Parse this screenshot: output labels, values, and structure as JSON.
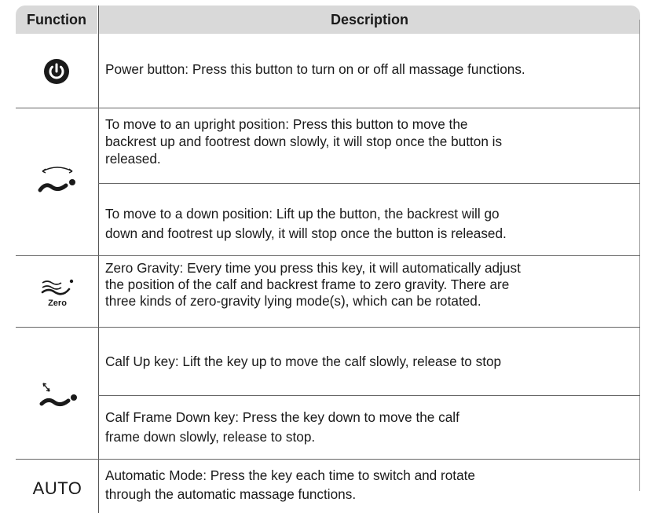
{
  "header": {
    "function": "Function",
    "description": "Description"
  },
  "rows": [
    {
      "icon": "power-icon",
      "lines": [
        "Power button: Press this button to turn on or off all massage functions."
      ]
    },
    {
      "icon": "recline-up-down-icon",
      "lines": [
        "To move to an upright position: Press this button to move the",
        "backrest up and footrest down slowly, it will stop once the button is",
        "released."
      ],
      "lines2": [
        "To move to a down position: Lift up the button, the backrest will go",
        "down and footrest up slowly, it will stop once the button is released."
      ]
    },
    {
      "icon": "zero-gravity-icon",
      "icon_label": "Zero",
      "lines": [
        "Zero Gravity: Every time you press this key,  it will automatically adjust",
        "the position of the calf and backrest frame to  zero gravity. There are",
        "three kinds of zero-gravity lying mode(s), which can be rotated."
      ]
    },
    {
      "icon": "calf-adjust-icon",
      "lines": [
        "Calf Up key: Lift the key up to move the calf slowly, release to stop"
      ],
      "lines2": [
        "Calf Frame Down key: Press the key down to move the calf",
        "frame down slowly, release to stop."
      ]
    },
    {
      "icon": "auto-label",
      "icon_label": "AUTO",
      "lines": [
        "Automatic Mode: Press the key each time to switch and rotate",
        "through the  automatic massage functions."
      ]
    }
  ]
}
